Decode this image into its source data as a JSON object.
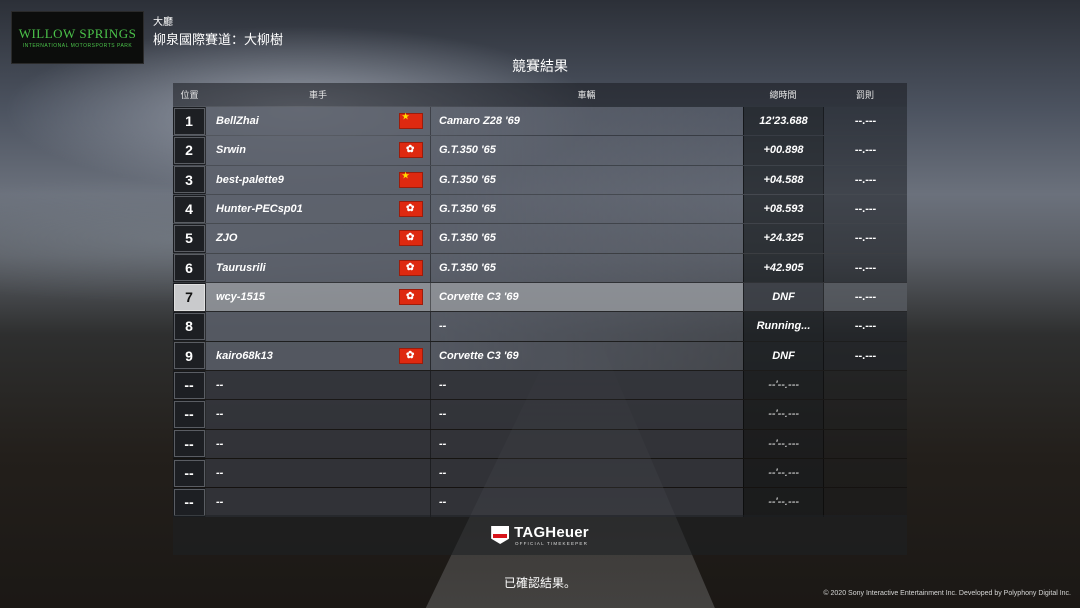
{
  "header": {
    "logo_text": "WILLOW SPRINGS",
    "logo_subtext": "INTERNATIONAL MOTORSPORTS PARK",
    "event_type": "大廳",
    "track_name": "柳泉國際賽道：大柳樹"
  },
  "results": {
    "title": "競賽結果",
    "columns": [
      "位置",
      "車手",
      "車輛",
      "總時間",
      "罰則"
    ],
    "rows": [
      {
        "position": "1",
        "driver": "BellZhai",
        "flag": "cn-flag-icon",
        "car": "Camaro Z28 '69",
        "time": "12'23.688",
        "penalty": "--.---",
        "state": "normal"
      },
      {
        "position": "2",
        "driver": "Srwin",
        "flag": "hk-flag-icon",
        "car": "G.T.350 '65",
        "time": "+00.898",
        "penalty": "--.---",
        "state": "normal"
      },
      {
        "position": "3",
        "driver": "best-palette9",
        "flag": "cn-flag-icon",
        "car": "G.T.350 '65",
        "time": "+04.588",
        "penalty": "--.---",
        "state": "normal"
      },
      {
        "position": "4",
        "driver": "Hunter-PECsp01",
        "flag": "hk-flag-icon",
        "car": "G.T.350 '65",
        "time": "+08.593",
        "penalty": "--.---",
        "state": "normal"
      },
      {
        "position": "5",
        "driver": "ZJO",
        "flag": "hk-flag-icon",
        "car": "G.T.350 '65",
        "time": "+24.325",
        "penalty": "--.---",
        "state": "normal"
      },
      {
        "position": "6",
        "driver": "Taurusrili",
        "flag": "hk-flag-icon",
        "car": "G.T.350 '65",
        "time": "+42.905",
        "penalty": "--.---",
        "state": "normal"
      },
      {
        "position": "7",
        "driver": "wcy-1515",
        "flag": "hk-flag-icon",
        "car": "Corvette C3 '69",
        "time": "DNF",
        "penalty": "--.---",
        "state": "self"
      },
      {
        "position": "8",
        "driver": "",
        "flag": "",
        "car": "--",
        "time": "Running...",
        "penalty": "--.---",
        "state": "normal"
      },
      {
        "position": "9",
        "driver": "kairo68k13",
        "flag": "hk-flag-icon",
        "car": "Corvette C3 '69",
        "time": "DNF",
        "penalty": "--.---",
        "state": "normal"
      },
      {
        "position": "--",
        "driver": "--",
        "flag": "",
        "car": "--",
        "time": "--'--.---",
        "penalty": "",
        "state": "dim"
      },
      {
        "position": "--",
        "driver": "--",
        "flag": "",
        "car": "--",
        "time": "--'--.---",
        "penalty": "",
        "state": "dim"
      },
      {
        "position": "--",
        "driver": "--",
        "flag": "",
        "car": "--",
        "time": "--'--.---",
        "penalty": "",
        "state": "dim"
      },
      {
        "position": "--",
        "driver": "--",
        "flag": "",
        "car": "--",
        "time": "--'--.---",
        "penalty": "",
        "state": "dim"
      },
      {
        "position": "--",
        "driver": "--",
        "flag": "",
        "car": "--",
        "time": "--'--.---",
        "penalty": "",
        "state": "dim"
      }
    ]
  },
  "sponsor": {
    "brand": "TAGHeuer",
    "tagline": "OFFICIAL TIMEKEEPER"
  },
  "footer": {
    "confirm_text": "已確認結果。",
    "copyright": "© 2020 Sony Interactive Entertainment Inc. Developed by Polyphony Digital Inc."
  }
}
